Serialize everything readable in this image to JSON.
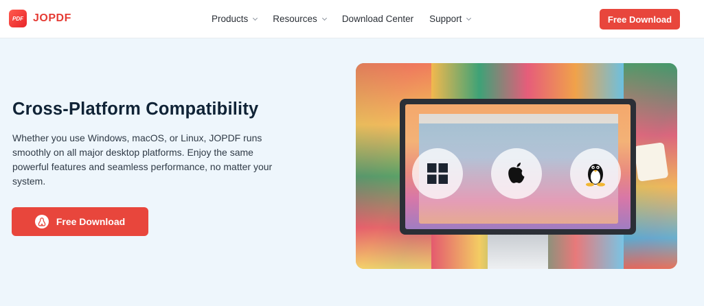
{
  "brand": {
    "logo_mark": "PDF",
    "name": "JOPDF",
    "color": "#e53b34"
  },
  "nav": {
    "items": [
      {
        "label": "Products",
        "has_dropdown": true
      },
      {
        "label": "Resources",
        "has_dropdown": true
      },
      {
        "label": "Download Center",
        "has_dropdown": false
      },
      {
        "label": "Support",
        "has_dropdown": true
      }
    ],
    "cta_label": "Free Download"
  },
  "hero": {
    "title": "Cross-Platform Compatibility",
    "description": "Whether you use Windows, macOS, or Linux, JOPDF runs smoothly on all major desktop platforms. Enjoy the same powerful features and seamless performance, no matter your system.",
    "button_label": "Free Download",
    "button_icon": "linux-icon"
  },
  "illustration": {
    "os_icons": [
      "windows-icon",
      "apple-icon",
      "linux-icon"
    ]
  },
  "colors": {
    "accent": "#e8463c",
    "page_bg": "#eef6fc",
    "title": "#102336"
  }
}
